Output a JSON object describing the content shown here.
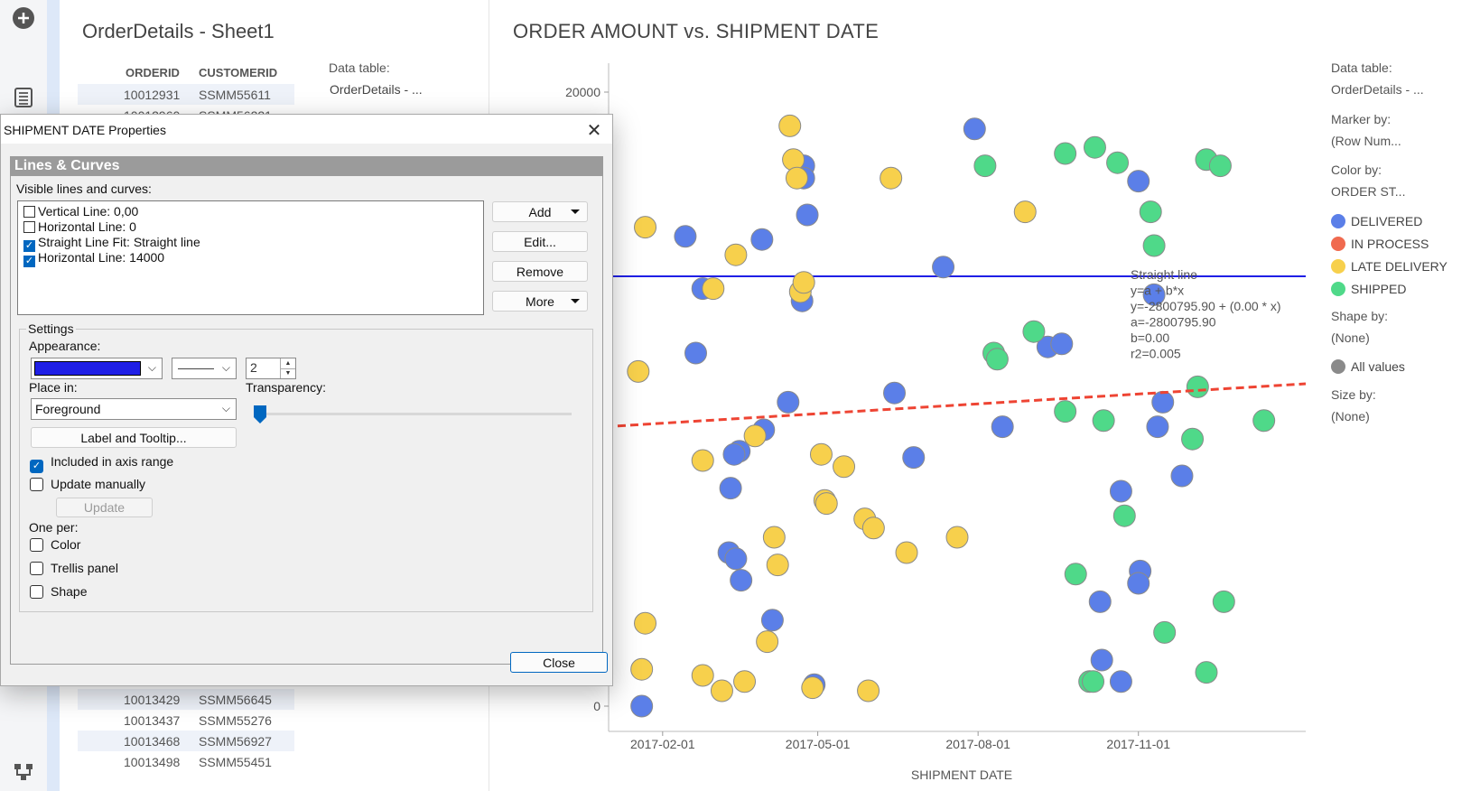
{
  "table_panel": {
    "title": "OrderDetails - Sheet1",
    "columns": [
      "ORDERID",
      "CUSTOMERID"
    ],
    "rows": [
      [
        "10012931",
        "SSMM55611"
      ],
      [
        "10012960",
        "SSMM56221"
      ],
      [
        "10013429",
        "SSMM56645"
      ],
      [
        "10013437",
        "SSMM55276"
      ],
      [
        "10013468",
        "SSMM56927"
      ],
      [
        "10013498",
        "SSMM55451"
      ]
    ],
    "data_table_label": "Data table:",
    "data_table_value": "OrderDetails - ..."
  },
  "chart_panel": {
    "title": "ORDER AMOUNT vs. SHIPMENT DATE",
    "legend": {
      "data_table_label": "Data table:",
      "data_table_value": "OrderDetails - ...",
      "marker_by_label": "Marker by:",
      "marker_by_value": "(Row Num...",
      "color_by_label": "Color by:",
      "color_by_value": "ORDER ST...",
      "shape_by_label": "Shape by:",
      "shape_by_value": "(None)",
      "all_values_label": "All values",
      "size_by_label": "Size by:",
      "size_by_value": "(None)"
    }
  },
  "chart_data": {
    "type": "scatter",
    "xlabel": "SHIPMENT DATE",
    "ylabel": "",
    "x_ticks": [
      "2017-02-01",
      "2017-05-01",
      "2017-08-01",
      "2017-11-01"
    ],
    "y_ticks": [
      "0",
      "20000"
    ],
    "ylim": [
      0,
      20000
    ],
    "series": [
      {
        "name": "DELIVERED",
        "color": "#5b7fe8",
        "points": [
          [
            "2017-01-20",
            0
          ],
          [
            "2017-02-14",
            15300
          ],
          [
            "2017-02-24",
            13600
          ],
          [
            "2017-02-20",
            11500
          ],
          [
            "2017-03-12",
            7100
          ],
          [
            "2017-03-17",
            8300
          ],
          [
            "2017-03-30",
            15200
          ],
          [
            "2017-03-31",
            9000
          ],
          [
            "2017-04-14",
            9900
          ],
          [
            "2017-04-22",
            13200
          ],
          [
            "2017-04-23",
            17600
          ],
          [
            "2017-04-23",
            17200
          ],
          [
            "2017-04-25",
            16000
          ],
          [
            "2017-04-05",
            2800
          ],
          [
            "2017-03-18",
            4100
          ],
          [
            "2017-03-11",
            5000
          ],
          [
            "2017-03-15",
            4800
          ],
          [
            "2017-03-14",
            8200
          ],
          [
            "2017-06-25",
            8100
          ],
          [
            "2017-06-14",
            10200
          ],
          [
            "2017-07-12",
            14300
          ],
          [
            "2017-07-30",
            18800
          ],
          [
            "2017-08-15",
            9100
          ],
          [
            "2017-09-10",
            11700
          ],
          [
            "2017-09-18",
            11800
          ],
          [
            "2017-10-11",
            1500
          ],
          [
            "2017-10-22",
            800
          ],
          [
            "2017-10-22",
            7000
          ],
          [
            "2017-11-10",
            13400
          ],
          [
            "2017-11-15",
            9900
          ],
          [
            "2017-11-01",
            17100
          ],
          [
            "2017-11-12",
            9100
          ],
          [
            "2017-11-26",
            7500
          ],
          [
            "2017-11-02",
            4400
          ],
          [
            "2017-11-01",
            4000
          ],
          [
            "2017-10-10",
            3400
          ],
          [
            "2017-04-29",
            700
          ]
        ]
      },
      {
        "name": "IN PROCESS",
        "color": "#f06a4f",
        "points": []
      },
      {
        "name": "LATE DELIVERY",
        "color": "#f7d04c",
        "points": [
          [
            "2017-01-20",
            1200
          ],
          [
            "2017-01-22",
            15600
          ],
          [
            "2017-01-18",
            10900
          ],
          [
            "2017-02-24",
            8000
          ],
          [
            "2017-03-02",
            13600
          ],
          [
            "2017-03-15",
            14700
          ],
          [
            "2017-03-26",
            8800
          ],
          [
            "2017-02-24",
            1000
          ],
          [
            "2017-03-20",
            800
          ],
          [
            "2017-04-02",
            2100
          ],
          [
            "2017-04-08",
            4600
          ],
          [
            "2017-04-06",
            5500
          ],
          [
            "2017-04-15",
            18900
          ],
          [
            "2017-04-17",
            17800
          ],
          [
            "2017-04-19",
            17200
          ],
          [
            "2017-04-21",
            13500
          ],
          [
            "2017-04-23",
            13800
          ],
          [
            "2017-05-03",
            8200
          ],
          [
            "2017-05-05",
            6700
          ],
          [
            "2017-05-06",
            6600
          ],
          [
            "2017-05-16",
            7800
          ],
          [
            "2017-05-28",
            6100
          ],
          [
            "2017-06-02",
            5800
          ],
          [
            "2017-06-12",
            17200
          ],
          [
            "2017-06-21",
            5000
          ],
          [
            "2017-07-20",
            5500
          ],
          [
            "2017-08-28",
            16100
          ],
          [
            "2017-05-30",
            500
          ],
          [
            "2017-03-07",
            500
          ],
          [
            "2017-01-22",
            2700
          ],
          [
            "2017-04-28",
            600
          ]
        ]
      },
      {
        "name": "SHIPPED",
        "color": "#4fd989",
        "points": [
          [
            "2017-09-20",
            18000
          ],
          [
            "2017-10-07",
            18200
          ],
          [
            "2017-10-20",
            17700
          ],
          [
            "2017-08-05",
            17600
          ],
          [
            "2017-08-10",
            11500
          ],
          [
            "2017-08-12",
            11300
          ],
          [
            "2017-09-02",
            12200
          ],
          [
            "2017-09-20",
            9600
          ],
          [
            "2017-10-12",
            9300
          ],
          [
            "2017-10-24",
            6200
          ],
          [
            "2017-11-08",
            16100
          ],
          [
            "2017-11-10",
            15000
          ],
          [
            "2017-12-10",
            17800
          ],
          [
            "2017-12-18",
            17600
          ],
          [
            "2017-12-05",
            10400
          ],
          [
            "2017-12-02",
            8700
          ],
          [
            "2018-01-12",
            9300
          ],
          [
            "2017-09-26",
            4300
          ],
          [
            "2017-12-20",
            3400
          ],
          [
            "2017-11-16",
            2400
          ],
          [
            "2017-12-10",
            1100
          ],
          [
            "2017-10-04",
            800
          ],
          [
            "2017-10-06",
            800
          ]
        ]
      }
    ],
    "horizontal_line": {
      "value": 14000,
      "color": "#1f1fe6"
    },
    "fit_line": {
      "label": "Straight line",
      "formula": "y=a + b*x",
      "equation": "y=-2800795.90 + (0.00 * x)",
      "a": "a=-2800795.90",
      "b": "b=0.00",
      "r2": "r2=0.005",
      "color": "#ee4433",
      "y_start": 9100,
      "y_end": 10500
    }
  },
  "dialog": {
    "title": "SHIPMENT DATE Properties",
    "section": "Lines & Curves",
    "visible_label": "Visible lines and curves:",
    "lines": [
      {
        "label": "Vertical Line: 0,00",
        "checked": false
      },
      {
        "label": "Horizontal Line: 0",
        "checked": false
      },
      {
        "label": "Straight Line Fit: Straight line",
        "checked": true
      },
      {
        "label": "Horizontal Line: 14000",
        "checked": true
      }
    ],
    "buttons": {
      "add": "Add",
      "edit": "Edit...",
      "remove": "Remove",
      "more": "More"
    },
    "settings_label": "Settings",
    "appearance_label": "Appearance:",
    "line_width": "2",
    "place_in_label": "Place in:",
    "place_in_value": "Foreground",
    "transparency_label": "Transparency:",
    "transparency": 0,
    "label_tooltip_button": "Label and Tooltip...",
    "included_axis_label": "Included in axis range",
    "update_manually_label": "Update manually",
    "update_button": "Update",
    "one_per_label": "One per:",
    "one_per_color": "Color",
    "one_per_trellis": "Trellis panel",
    "one_per_shape": "Shape",
    "close_button": "Close"
  }
}
